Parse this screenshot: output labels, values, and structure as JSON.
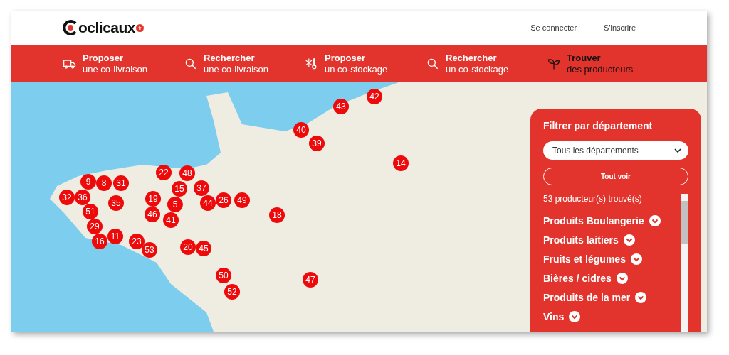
{
  "header": {
    "logo": {
      "text": "oclicaux",
      "badge": "fr"
    },
    "links": [
      {
        "label": "Se connecter"
      },
      {
        "label": "S'inscrire"
      }
    ]
  },
  "nav": [
    {
      "title": "Proposer",
      "subtitle": "une co-livraison"
    },
    {
      "title": "Rechercher",
      "subtitle": "une co-livraison"
    },
    {
      "title": "Proposer",
      "subtitle": "un co-stockage"
    },
    {
      "title": "Rechercher",
      "subtitle": "un co-stockage"
    },
    {
      "title": "Trouver",
      "subtitle": "des producteurs"
    }
  ],
  "map": {
    "markers": [
      {
        "label": "42"
      },
      {
        "label": "43"
      },
      {
        "label": "40"
      },
      {
        "label": "39"
      },
      {
        "label": "14"
      },
      {
        "label": "22"
      },
      {
        "label": "48"
      },
      {
        "label": "9"
      },
      {
        "label": "8"
      },
      {
        "label": "31"
      },
      {
        "label": "15"
      },
      {
        "label": "37"
      },
      {
        "label": "32"
      },
      {
        "label": "36"
      },
      {
        "label": "35"
      },
      {
        "label": "19"
      },
      {
        "label": "5"
      },
      {
        "label": "44"
      },
      {
        "label": "26"
      },
      {
        "label": "49"
      },
      {
        "label": "51"
      },
      {
        "label": "46"
      },
      {
        "label": "41"
      },
      {
        "label": "18"
      },
      {
        "label": "29"
      },
      {
        "label": "16"
      },
      {
        "label": "11"
      },
      {
        "label": "23"
      },
      {
        "label": "53"
      },
      {
        "label": "20"
      },
      {
        "label": "45"
      },
      {
        "label": "50"
      },
      {
        "label": "47"
      },
      {
        "label": "52"
      }
    ]
  },
  "filter": {
    "title": "Filtrer par département",
    "select": {
      "value": "Tous les départements"
    },
    "button": "Tout voir",
    "count": "53 producteur(s) trouvé(s)",
    "categories": [
      {
        "label": "Produits Boulangerie"
      },
      {
        "label": "Produits laitiers"
      },
      {
        "label": "Fruits et légumes"
      },
      {
        "label": "Bières / cidres"
      },
      {
        "label": "Produits de la mer"
      },
      {
        "label": "Vins"
      }
    ]
  }
}
